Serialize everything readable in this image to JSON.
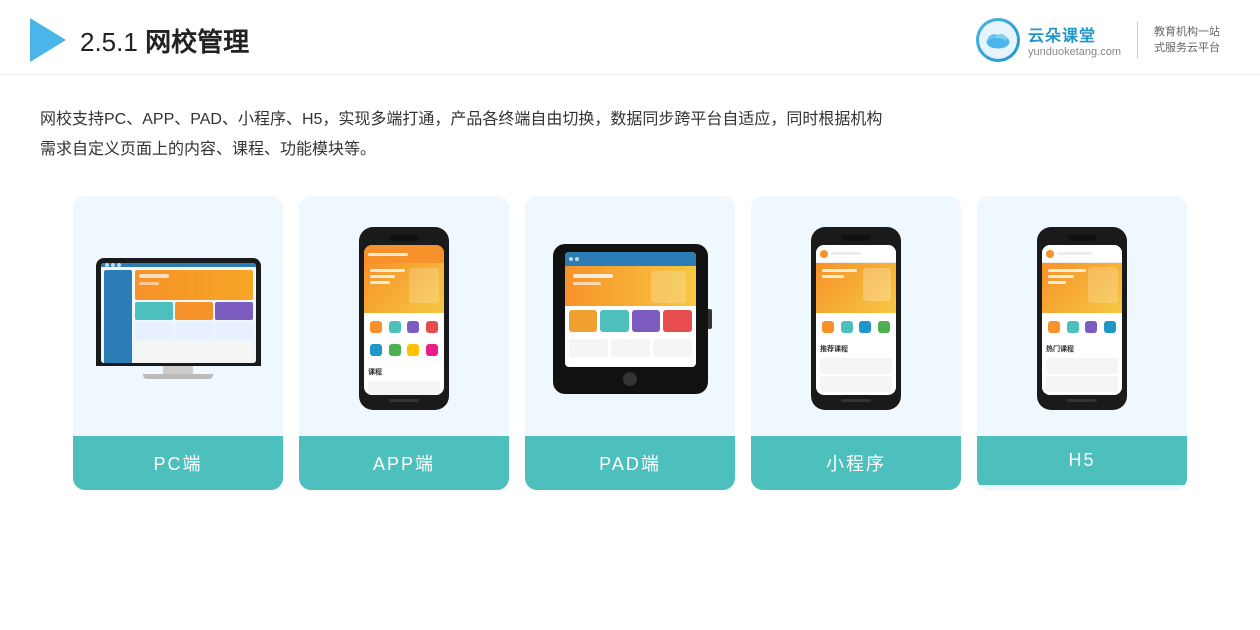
{
  "header": {
    "section_number": "2.5.1",
    "title_plain": "2.5.1 ",
    "title_bold": "网校管理",
    "logo_brand": "云朵课堂",
    "logo_url": "yunduoketang.com",
    "logo_tagline_line1": "教育机构一站",
    "logo_tagline_line2": "式服务云平台"
  },
  "description": {
    "line1": "网校支持PC、APP、PAD、小程序、H5，实现多端打通，产品各终端自由切换，数据同步跨平台自适应，同时根据机构",
    "line2": "需求自定义页面上的内容、课程、功能模块等。"
  },
  "cards": [
    {
      "id": "pc",
      "label": "PC端",
      "type": "pc"
    },
    {
      "id": "app",
      "label": "APP端",
      "type": "phone"
    },
    {
      "id": "pad",
      "label": "PAD端",
      "type": "pad"
    },
    {
      "id": "mini",
      "label": "小程序",
      "type": "phone-mini"
    },
    {
      "id": "h5",
      "label": "H5",
      "type": "phone-h5"
    }
  ]
}
